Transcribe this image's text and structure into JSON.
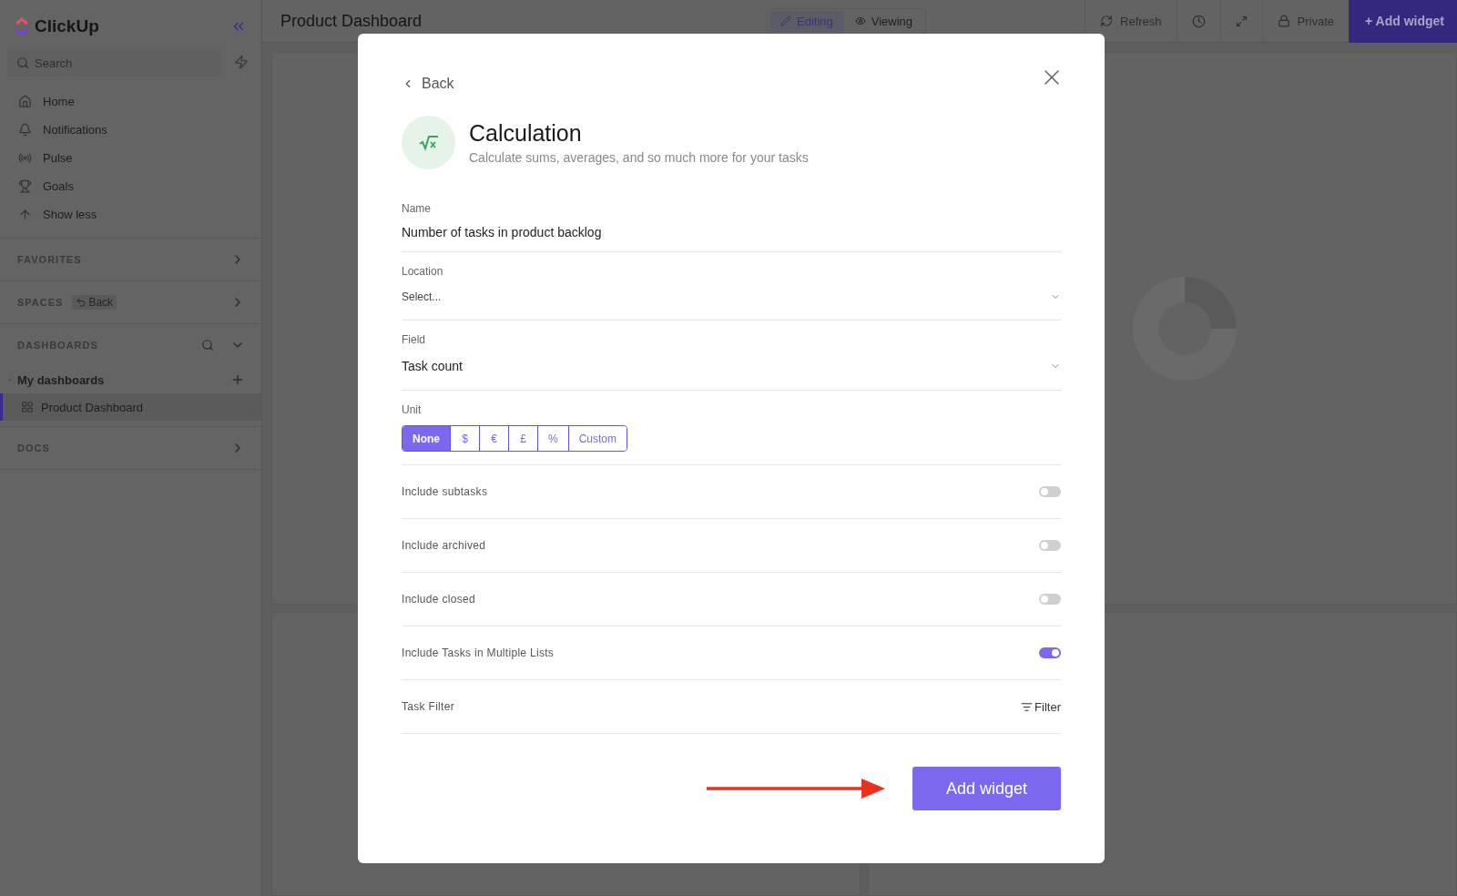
{
  "sidebar": {
    "logo": "ClickUp",
    "search": {
      "placeholder": "Search"
    },
    "nav": [
      {
        "label": "Home"
      },
      {
        "label": "Notifications"
      },
      {
        "label": "Pulse"
      },
      {
        "label": "Goals"
      },
      {
        "label": "Show less"
      }
    ],
    "sections": [
      {
        "kind": "collapsed",
        "title": "FAVORITES"
      },
      {
        "kind": "badge",
        "title": "SPACES",
        "badge": "Back"
      },
      {
        "kind": "tree",
        "title": "DASHBOARDS",
        "children": [
          {
            "label": "My dashboards",
            "expanded": true,
            "children": [
              {
                "label": "Product Dashboard",
                "selected": true
              }
            ]
          }
        ]
      },
      {
        "kind": "collapsed",
        "title": "DOCS"
      }
    ]
  },
  "header": {
    "title": "Product Dashboard",
    "modes": [
      {
        "label": "Editing",
        "selected": true
      },
      {
        "label": "Viewing",
        "selected": false
      }
    ],
    "actions": [
      {
        "kind": "text",
        "label": "Refresh"
      },
      {
        "kind": "icon"
      },
      {
        "kind": "icon"
      },
      {
        "kind": "text",
        "label": "Private"
      },
      {
        "kind": "primary",
        "label": "+ Add widget"
      }
    ]
  },
  "modal": {
    "back": "Back",
    "title": "Calculation",
    "subtitle": "Calculate sums, averages, and so much more for your tasks",
    "name": {
      "label": "Name",
      "value": "Number of tasks in product backlog"
    },
    "location": {
      "label": "Location",
      "placeholder": "Select..."
    },
    "field": {
      "label": "Field",
      "value": "Task count"
    },
    "unit": {
      "label": "Unit",
      "options": [
        {
          "label": "None",
          "selected": true
        },
        {
          "label": "$",
          "selected": false
        },
        {
          "label": "€",
          "selected": false
        },
        {
          "label": "£",
          "selected": false
        },
        {
          "label": "%",
          "selected": false
        },
        {
          "label": "Custom",
          "selected": false
        }
      ]
    },
    "toggles": [
      {
        "label": "Include subtasks",
        "on": false
      },
      {
        "label": "Include archived",
        "on": false
      },
      {
        "label": "Include closed",
        "on": false
      },
      {
        "label": "Include Tasks in Multiple Lists",
        "on": true
      }
    ],
    "task_filter": {
      "label": "Task Filter",
      "button": "Filter"
    },
    "submit": "Add widget"
  }
}
